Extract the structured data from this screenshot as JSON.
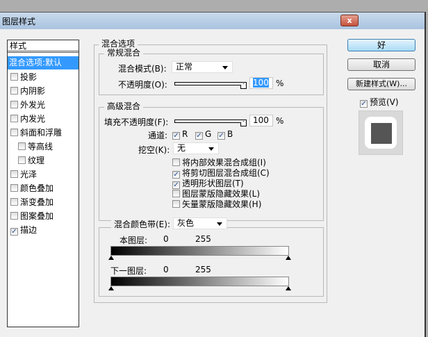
{
  "title": "图层样式",
  "close": "x",
  "styles_list": {
    "header": "样式",
    "selected": "混合选项:默认",
    "items": [
      {
        "label": "投影",
        "checked": false
      },
      {
        "label": "内阴影",
        "checked": false
      },
      {
        "label": "外发光",
        "checked": false
      },
      {
        "label": "内发光",
        "checked": false
      },
      {
        "label": "斜面和浮雕",
        "checked": false
      },
      {
        "label": "等高线",
        "checked": false,
        "sub": true
      },
      {
        "label": "纹理",
        "checked": false,
        "sub": true
      },
      {
        "label": "光泽",
        "checked": false
      },
      {
        "label": "颜色叠加",
        "checked": false
      },
      {
        "label": "渐变叠加",
        "checked": false
      },
      {
        "label": "图案叠加",
        "checked": false
      },
      {
        "label": "描边",
        "checked": true
      }
    ]
  },
  "blend": {
    "title": "混合选项",
    "general": {
      "title": "常规混合",
      "mode_label": "混合模式(B):",
      "mode_value": "正常",
      "opacity_label": "不透明度(O):",
      "opacity_value": "100",
      "opacity_unit": "%"
    },
    "advanced": {
      "title": "高级混合",
      "fill_label": "填充不透明度(F):",
      "fill_value": "100",
      "fill_unit": "%",
      "channels_label": "通道:",
      "channels": [
        "R",
        "G",
        "B"
      ],
      "knockout_label": "挖空(K):",
      "knockout_value": "无",
      "options": [
        {
          "label": "将内部效果混合成组(I)",
          "checked": false
        },
        {
          "label": "将剪切图层混合成组(C)",
          "checked": true
        },
        {
          "label": "透明形状图层(T)",
          "checked": true
        },
        {
          "label": "图层蒙版隐藏效果(L)",
          "checked": false
        },
        {
          "label": "矢量蒙版隐藏效果(H)",
          "checked": false
        }
      ]
    },
    "band": {
      "label": "混合颜色带(E):",
      "value": "灰色",
      "this_layer": "本图层:",
      "this_min": "0",
      "this_max": "255",
      "under_layer": "下一图层:",
      "under_min": "0",
      "under_max": "255"
    }
  },
  "buttons": {
    "ok": "好",
    "cancel": "取消",
    "new_style": "新建样式(W)...",
    "preview": "预览(V)",
    "preview_checked": true
  }
}
